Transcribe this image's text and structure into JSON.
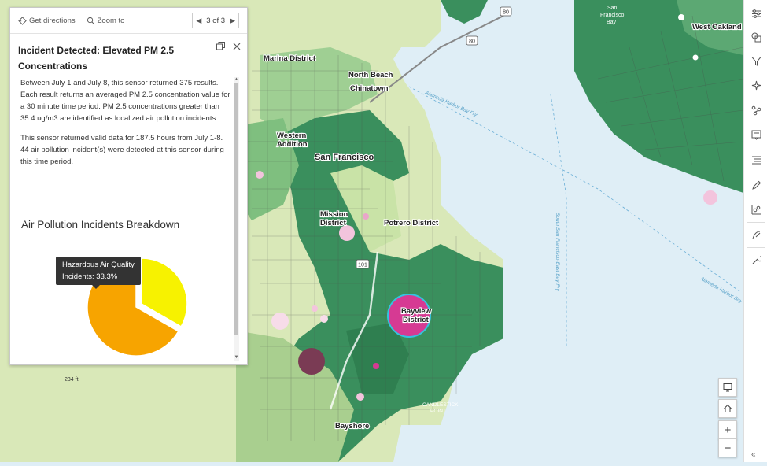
{
  "popup": {
    "toolbar": {
      "directions_label": "Get directions",
      "zoom_label": "Zoom to",
      "pager_text": "3 of 3"
    },
    "title_line1": "Incident Detected: Elevated PM 2.5",
    "title_line2": "Concentrations",
    "paragraph1": "Between July 1 and July 8, this sensor returned 375 results. Each result returns an averaged PM 2.5 concentration value for a 30 minute time period.  PM 2.5 concentrations greater than 35.4 ug/m3 are identified as localized air pollution incidents.",
    "paragraph2": "This sensor returned valid data for 187.5  hours from July 1-8. 44  air pollution incident(s) were detected at this sensor during this time period.",
    "chart_title": "Air Pollution Incidents Breakdown",
    "tooltip_line1": "Hazardous Air Quality",
    "tooltip_line2": "Incidents: 33.3%"
  },
  "chart_data": {
    "type": "pie",
    "title": "Air Pollution Incidents Breakdown",
    "slices": [
      {
        "label": "Hazardous Air Quality Incidents",
        "value": 33.3,
        "color": "#f7f200"
      },
      {
        "label": "",
        "value": 66.7,
        "color": "#f7a400"
      }
    ]
  },
  "map": {
    "labels": {
      "marina": "Marina District",
      "north_beach": "North Beach",
      "chinatown": "Chinatown",
      "western_addition_1": "Western",
      "western_addition_2": "Addition",
      "san_francisco": "San Francisco",
      "mission_1": "Mission",
      "mission_2": "District",
      "potrero": "Potrero District",
      "bayview_1": "Bayview",
      "bayview_2": "District",
      "bayshore": "Bayshore",
      "candlestick_1": "CANDLESTICK",
      "candlestick_2": "POINT",
      "west_oakland": "West Oakland",
      "sf_bay_1": "San",
      "sf_bay_2": "Francisco",
      "sf_bay_3": "Bay",
      "alameda_ferry": "Alameda Harbor Bay Fry",
      "alameda_ferry2": "Alameda Harbor Bay Fry",
      "ssf_ferry": "South San Francisco-East Bay Fry",
      "hwy80": "80",
      "hwy101": "101",
      "street_234th": "234 ft"
    }
  },
  "colors": {
    "accent_pink": "#d63a93",
    "dark_pin": "#7a3b54",
    "green_dark": "#2e8b57",
    "water": "#dfeef6"
  }
}
